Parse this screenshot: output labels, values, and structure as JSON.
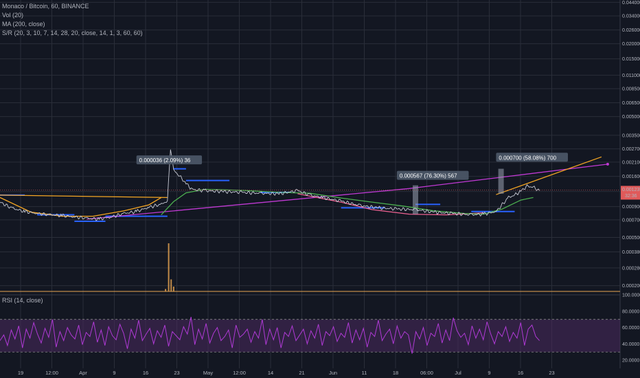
{
  "legend": {
    "symbol": "Monaco / Bitcoin, 60, BINANCE",
    "volume": "Vol (20)",
    "ma": "MA (200, close)",
    "sr": "S/R (20, 3, 10, 7, 14, 28, 20, close, 14, 1, 3, 60, 60)",
    "rsi": "RSI (14, close)"
  },
  "colors": {
    "background": "#131722",
    "grid": "#2a2e39",
    "price": "#c8cbd6",
    "ma": "#4caf50",
    "curve": "#f06292",
    "support": "#2962ff",
    "trend_orange": "#f5a623",
    "trend_magenta": "#c039d3",
    "rsi": "#b03ad6",
    "rsi_band": "#4a2a5e",
    "volume": "#e0a050",
    "measure_box": "#9aa3b3",
    "last_price_bg": "#e05a5a"
  },
  "chart_data": [
    {
      "type": "line",
      "name": "price",
      "log_scale": true,
      "x_tick_labels": [
        "19",
        "12:00",
        "Apr",
        "9",
        "16",
        "23",
        "May",
        "12:00",
        "14",
        "21",
        "Jun",
        "11",
        "18",
        "06:00",
        "Jul",
        "9",
        "16",
        "23"
      ],
      "y_tick_labels": [
        "0.044000",
        "0.034000",
        "0.026000",
        "0.020000",
        "0.015000",
        "0.011000",
        "0.008500",
        "0.006500",
        "0.005000",
        "0.003500",
        "0.002700",
        "0.002100",
        "0.001600",
        "0.001200",
        "0.000900",
        "0.000700",
        "0.000500",
        "0.000380",
        "0.000280",
        "0.000200"
      ],
      "ylim": [
        0.00017,
        0.046
      ],
      "x_range_days": [
        0,
        100
      ],
      "series": [
        {
          "values_xy": [
            [
              0,
              0.00098
            ],
            [
              2,
              0.00087
            ],
            [
              4,
              0.00082
            ],
            [
              6,
              0.00079
            ],
            [
              8,
              0.00077
            ],
            [
              10,
              0.00076
            ],
            [
              12,
              0.00074
            ],
            [
              14,
              0.00072
            ],
            [
              16,
              0.00071
            ],
            [
              18,
              0.00074
            ],
            [
              20,
              0.00079
            ],
            [
              22,
              0.00082
            ],
            [
              24,
              0.00089
            ],
            [
              26,
              0.00094
            ],
            [
              27,
              0.001
            ],
            [
              27.5,
              0.0027
            ],
            [
              28,
              0.0018
            ],
            [
              29,
              0.0016
            ],
            [
              30,
              0.0014
            ],
            [
              31,
              0.00125
            ],
            [
              33,
              0.00122
            ],
            [
              36,
              0.0012
            ],
            [
              39,
              0.00118
            ],
            [
              42,
              0.00116
            ],
            [
              45,
              0.00115
            ],
            [
              48,
              0.00122
            ],
            [
              50,
              0.00112
            ],
            [
              52,
              0.00107
            ],
            [
              55,
              0.001
            ],
            [
              58,
              0.00092
            ],
            [
              61,
              0.00088
            ],
            [
              64,
              0.00086
            ],
            [
              67,
              0.00085
            ],
            [
              70,
              0.00081
            ],
            [
              73,
              0.00079
            ],
            [
              76,
              0.00077
            ],
            [
              78,
              0.00078
            ],
            [
              80,
              0.00082
            ],
            [
              82,
              0.00107
            ],
            [
              83,
              0.00112
            ],
            [
              84,
              0.00121
            ],
            [
              85,
              0.00133
            ],
            [
              86,
              0.0013
            ],
            [
              87,
              0.00122
            ]
          ]
        }
      ]
    },
    {
      "type": "line",
      "name": "MA (200, close)",
      "series": [
        {
          "values_xy": [
            [
              26,
              0.00077
            ],
            [
              28,
              0.00099
            ],
            [
              30,
              0.00117
            ],
            [
              33,
              0.00125
            ],
            [
              36,
              0.00124
            ],
            [
              40,
              0.00122
            ],
            [
              45,
              0.00118
            ],
            [
              50,
              0.00116
            ],
            [
              55,
              0.00106
            ],
            [
              60,
              0.00098
            ],
            [
              65,
              0.00091
            ],
            [
              70,
              0.00083
            ],
            [
              75,
              0.00079
            ],
            [
              78,
              0.00078
            ],
            [
              81,
              0.00086
            ],
            [
              84,
              0.00102
            ],
            [
              86,
              0.00107
            ]
          ]
        }
      ]
    },
    {
      "type": "line",
      "name": "trend lines",
      "series": [
        {
          "values_xy": [
            [
              0,
              0.00112
            ],
            [
              27,
              0.00107
            ]
          ]
        },
        {
          "values_xy": [
            [
              0,
              0.00107
            ],
            [
              5,
              0.00081
            ],
            [
              10,
              0.00075
            ],
            [
              15,
              0.00075
            ],
            [
              20,
              0.00083
            ],
            [
              24,
              0.00093
            ],
            [
              26,
              0.00107
            ]
          ]
        },
        {
          "values_xy": [
            [
              14,
              0.00071
            ],
            [
              66,
              0.00127
            ],
            [
              98,
              0.00202
            ]
          ]
        },
        {
          "values_xy": [
            [
              80,
              0.00113
            ],
            [
              97,
              0.00232
            ]
          ]
        }
      ]
    },
    {
      "type": "line",
      "name": "RSI (14, close)",
      "y_tick_labels": [
        "100.0000",
        "80.0000",
        "60.0000",
        "40.0000",
        "20.0000"
      ],
      "ylim": [
        10,
        100
      ],
      "bands": [
        70,
        30
      ],
      "values": [
        44,
        51,
        38,
        57,
        46,
        62,
        35,
        58,
        47,
        66,
        52,
        41,
        59,
        48,
        70,
        36,
        55,
        44,
        60,
        51,
        46,
        63,
        39,
        54,
        49,
        67,
        42,
        57,
        38,
        61,
        50,
        45,
        64,
        53,
        34,
        58,
        47,
        69,
        44,
        52,
        59,
        40,
        56,
        48,
        63,
        37,
        55,
        50,
        45,
        61,
        52,
        73,
        39,
        58,
        46,
        65,
        41,
        53,
        60,
        44,
        49,
        57,
        35,
        63,
        48,
        52,
        58,
        42,
        55,
        47,
        70,
        39,
        58,
        45,
        60,
        35,
        54,
        49,
        62,
        44,
        51,
        58,
        40,
        56,
        47,
        64,
        38,
        55,
        50,
        61,
        43,
        53,
        48,
        66,
        41,
        57,
        45,
        59,
        36,
        54,
        49,
        69,
        44,
        52,
        58,
        40,
        62,
        47,
        55,
        51,
        28,
        55,
        46,
        60,
        38,
        53,
        49,
        65,
        41,
        57,
        44,
        72,
        56,
        48,
        53,
        39,
        62,
        47,
        58,
        45,
        67,
        52,
        40,
        55,
        49,
        61,
        43,
        54,
        47,
        66,
        38,
        58,
        63,
        49,
        44
      ]
    },
    {
      "type": "bar",
      "name": "Vol (20)",
      "values_xy": [
        [
          26.7,
          0.05
        ],
        [
          27.2,
          1
        ],
        [
          27.6,
          0.25
        ],
        [
          28,
          0.1
        ]
      ]
    }
  ],
  "annotations": [
    {
      "text": "0.000036 (2.09%) 36",
      "x_day": 22,
      "y_price": 0.00212
    },
    {
      "text": "0.000567 (76.30%) 567",
      "x_day": 64,
      "y_price": 0.00158
    },
    {
      "text": "0.000700 (58.08%) 700",
      "x_day": 80,
      "y_price": 0.00223
    }
  ],
  "measure_boxes": [
    {
      "x_day": 67,
      "y_price_low": 0.00078,
      "y_price_high": 0.00135
    },
    {
      "x_day": 80.8,
      "y_price_low": 0.00115,
      "y_price_high": 0.00185
    }
  ],
  "support_segments": [
    {
      "x_day_from": 0,
      "x_day_to": 4,
      "y_price": 0.00112
    },
    {
      "x_day_from": 6,
      "x_day_to": 12,
      "y_price": 0.00077
    },
    {
      "x_day_from": 12,
      "x_day_to": 17,
      "y_price": 0.00068
    },
    {
      "x_day_from": 17,
      "x_day_to": 27,
      "y_price": 0.00075
    },
    {
      "x_day_from": 28,
      "x_day_to": 30,
      "y_price": 0.00185
    },
    {
      "x_day_from": 30,
      "x_day_to": 37,
      "y_price": 0.00148
    },
    {
      "x_day_from": 42,
      "x_day_to": 47,
      "y_price": 0.00118
    },
    {
      "x_day_from": 55,
      "x_day_to": 62,
      "y_price": 0.00088
    },
    {
      "x_day_from": 67,
      "x_day_to": 71,
      "y_price": 0.00094
    },
    {
      "x_day_from": 76,
      "x_day_to": 83,
      "y_price": 0.00082
    }
  ],
  "price_axis": {
    "last_price": "0.001235",
    "countdown": "32:36"
  }
}
